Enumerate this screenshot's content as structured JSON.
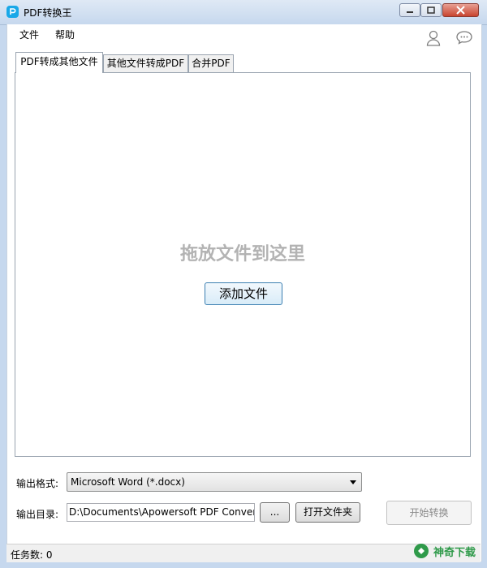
{
  "window": {
    "title": "PDF转换王",
    "app_icon": "p-icon",
    "controls": [
      "minimize-icon",
      "maximize-icon",
      "close-icon"
    ]
  },
  "menu": {
    "file": "文件",
    "help": "帮助"
  },
  "header_icons": [
    "user-icon",
    "chat-icon"
  ],
  "tabs": [
    {
      "label": "PDF转成其他文件",
      "active": true
    },
    {
      "label": "其他文件转成PDF",
      "active": false
    },
    {
      "label": "合并PDF",
      "active": false
    }
  ],
  "drop_area": {
    "hint": "拖放文件到这里",
    "add_button": "添加文件"
  },
  "output": {
    "format_label": "输出格式:",
    "format_value": "Microsoft Word (*.docx)",
    "dir_label": "输出目录:",
    "dir_value": "D:\\Documents\\Apowersoft PDF Conver",
    "browse_button": "...",
    "open_folder_button": "打开文件夹",
    "start_button": "开始转换"
  },
  "status": {
    "task_count": "任务数: 0"
  },
  "watermark": {
    "text": "神奇下载"
  },
  "colors": {
    "accent": "#19a8e8",
    "drop_hint": "#b3b3b3",
    "watermark": "#2f9a4a"
  }
}
